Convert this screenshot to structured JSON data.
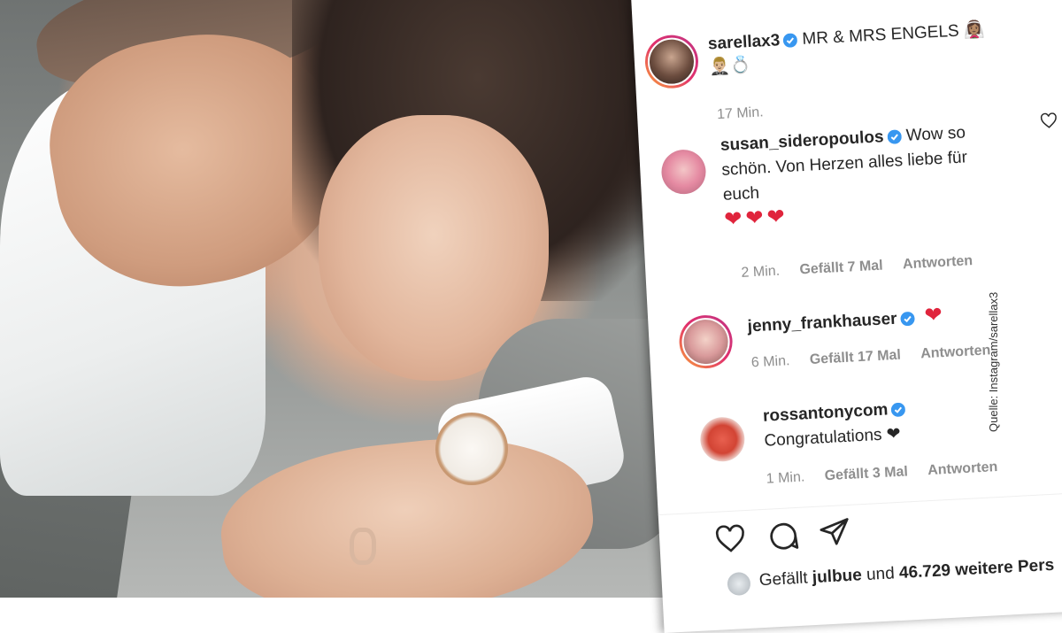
{
  "post": {
    "username": "sarellax3",
    "caption": "MR & MRS ENGELS 👰🏽‍♀️",
    "caption_line2": "🤵🏼‍♂️💍",
    "time": "17 Min."
  },
  "comments": [
    {
      "username": "susan_sideropoulos",
      "text_line1": "Wow so",
      "text_line2": "schön. Von Herzen alles liebe für",
      "text_line3": "euch",
      "hearts": "❤❤❤",
      "time": "2 Min.",
      "likes": "Gefällt 7 Mal",
      "reply": "Antworten"
    },
    {
      "username": "jenny_frankhauser",
      "text": "❤",
      "time": "6 Min.",
      "likes": "Gefällt 17 Mal",
      "reply": "Antworten"
    },
    {
      "username": "rossantonycom",
      "text": "Congratulations ❤",
      "time": "1 Min.",
      "likes": "Gefällt 3 Mal",
      "reply": "Antworten"
    }
  ],
  "likes_line": {
    "prefix": "Gefällt",
    "user": "julbue",
    "connector": "und",
    "count": "46.729 weitere Pers"
  },
  "source": "Quelle: Instagram/sarellax3",
  "colors": {
    "verified": "#3897f0",
    "heart": "#e0243c",
    "text": "#262626",
    "muted": "#8e8e8e"
  },
  "icons": {
    "like": "heart-outline-icon",
    "comment": "comment-bubble-icon",
    "share": "paper-plane-icon"
  }
}
